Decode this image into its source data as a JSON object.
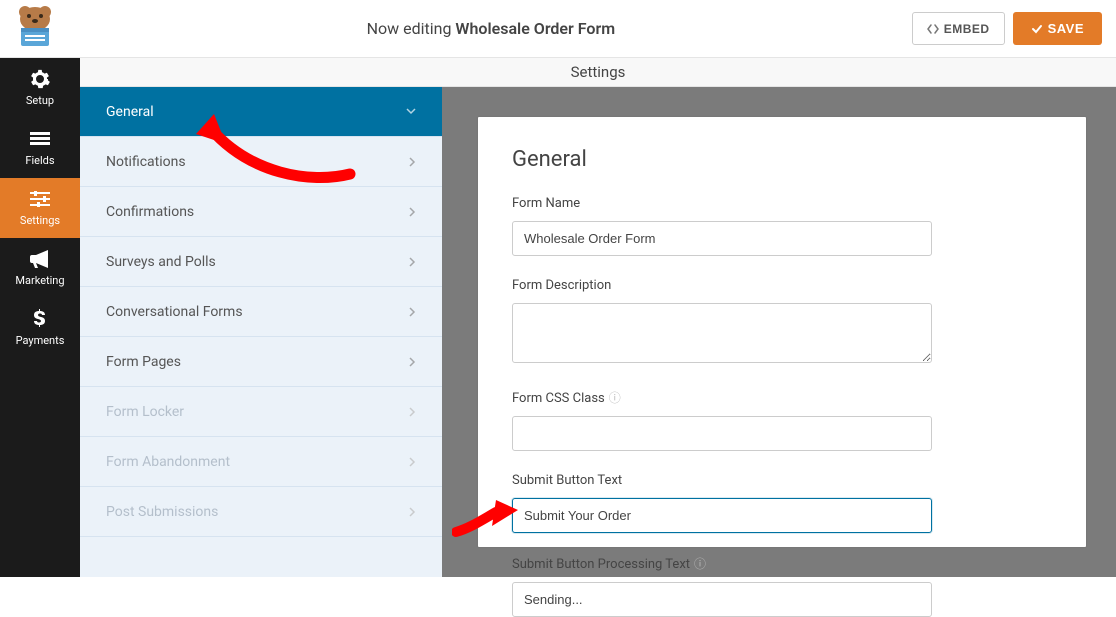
{
  "header": {
    "editing_prefix": "Now editing ",
    "form_title": "Wholesale Order Form",
    "embed_label": "EMBED",
    "save_label": "SAVE"
  },
  "nav": {
    "items": [
      {
        "id": "setup",
        "label": "Setup"
      },
      {
        "id": "fields",
        "label": "Fields"
      },
      {
        "id": "settings",
        "label": "Settings"
      },
      {
        "id": "marketing",
        "label": "Marketing"
      },
      {
        "id": "payments",
        "label": "Payments"
      }
    ],
    "active": "settings"
  },
  "settings_header": "Settings",
  "side": {
    "items": [
      {
        "label": "General",
        "state": "expanded"
      },
      {
        "label": "Notifications",
        "state": "normal"
      },
      {
        "label": "Confirmations",
        "state": "normal"
      },
      {
        "label": "Surveys and Polls",
        "state": "normal"
      },
      {
        "label": "Conversational Forms",
        "state": "normal"
      },
      {
        "label": "Form Pages",
        "state": "normal"
      },
      {
        "label": "Form Locker",
        "state": "disabled"
      },
      {
        "label": "Form Abandonment",
        "state": "disabled"
      },
      {
        "label": "Post Submissions",
        "state": "disabled"
      }
    ]
  },
  "form": {
    "heading": "General",
    "name_label": "Form Name",
    "name_value": "Wholesale Order Form",
    "description_label": "Form Description",
    "description_value": "",
    "css_label": "Form CSS Class",
    "css_value": "",
    "submit_label": "Submit Button Text",
    "submit_value": "Submit Your Order",
    "processing_label": "Submit Button Processing Text",
    "processing_value": "Sending..."
  }
}
